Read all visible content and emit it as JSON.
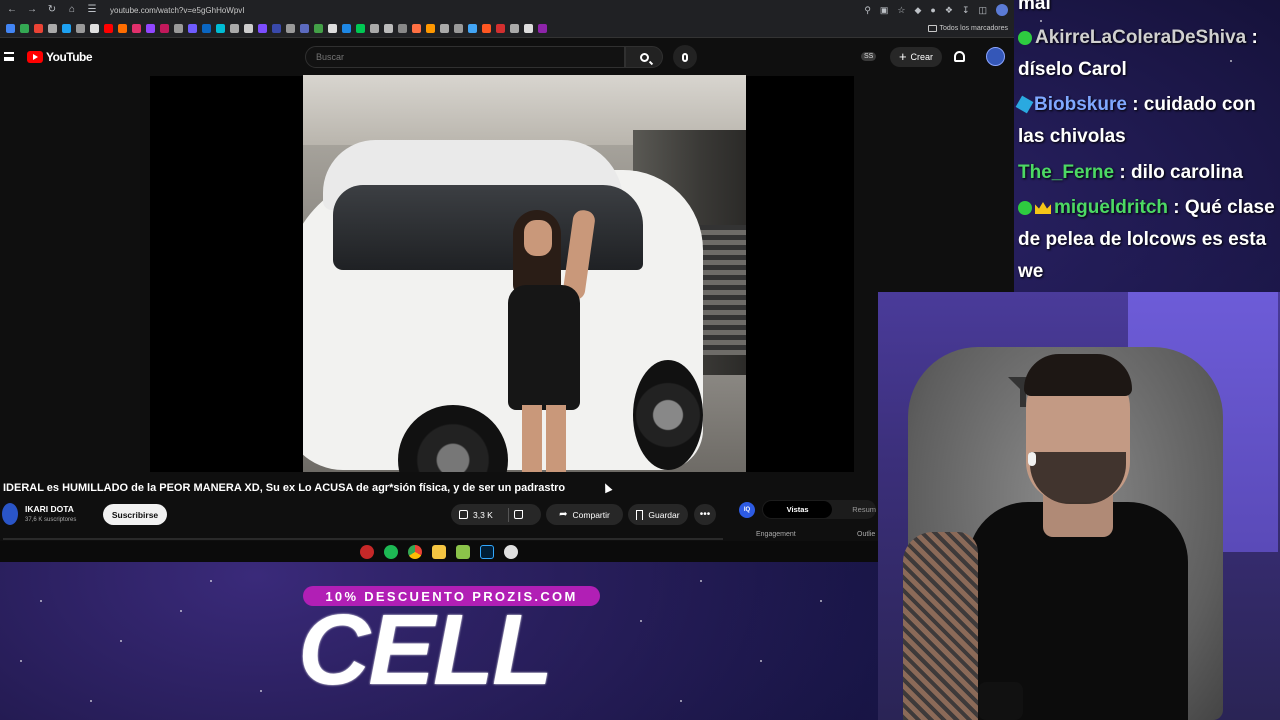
{
  "browser": {
    "url": "youtube.com/watch?v=e5gGhHoWpvI",
    "bookmarks_folder": "Todos los marcadores"
  },
  "youtube": {
    "logo_text": "YouTube",
    "search_placeholder": "Buscar",
    "cast_badge": "SS",
    "create_label": "Crear",
    "video_title": "IDERAL es HUMILLADO de la PEOR MANERA XD, Su ex Lo ACUSA de agr*sión física, y de ser un padrastro",
    "channel_name": "IKARI DOTA",
    "channel_subs": "37,6 K suscriptores",
    "subscribe_label": "Suscribirse",
    "likes": "3,3 K",
    "share_label": "Compartir",
    "save_label": "Guardar",
    "more_label": "•••",
    "side_panel": {
      "badge": "IQ",
      "tab_active": "Vistas",
      "tab_other": "Resum",
      "row_left": "Engagement",
      "row_right": "Outlie"
    }
  },
  "chat": [
    {
      "user": "",
      "message": "mal",
      "user_color": "#ffffff"
    },
    {
      "user": "AkirreLaColeraDeShiva",
      "message": ": díselo Carol",
      "user_color": "#d0d0d0",
      "badge": "green"
    },
    {
      "user": "Biobskure",
      "message": ": cuidado con las chivolas",
      "user_color": "#7fa8ff",
      "badge": "cube"
    },
    {
      "user": "The_Ferne",
      "message": ": dilo carolina",
      "user_color": "#4cd964"
    },
    {
      "user": "migueldritch",
      "message": ": Qué clase de pelea de lolcows es esta we",
      "user_color": "#4cd964",
      "badge": "green-crown"
    }
  ],
  "promo": {
    "banner": "10% DESCUENTO PROZIS.COM",
    "big_text": "CELL"
  },
  "colors": {
    "youtube_red": "#ff0000",
    "promo_magenta": "#b11fb5",
    "username_green": "#4cd964",
    "username_blue": "#7fa8ff"
  }
}
